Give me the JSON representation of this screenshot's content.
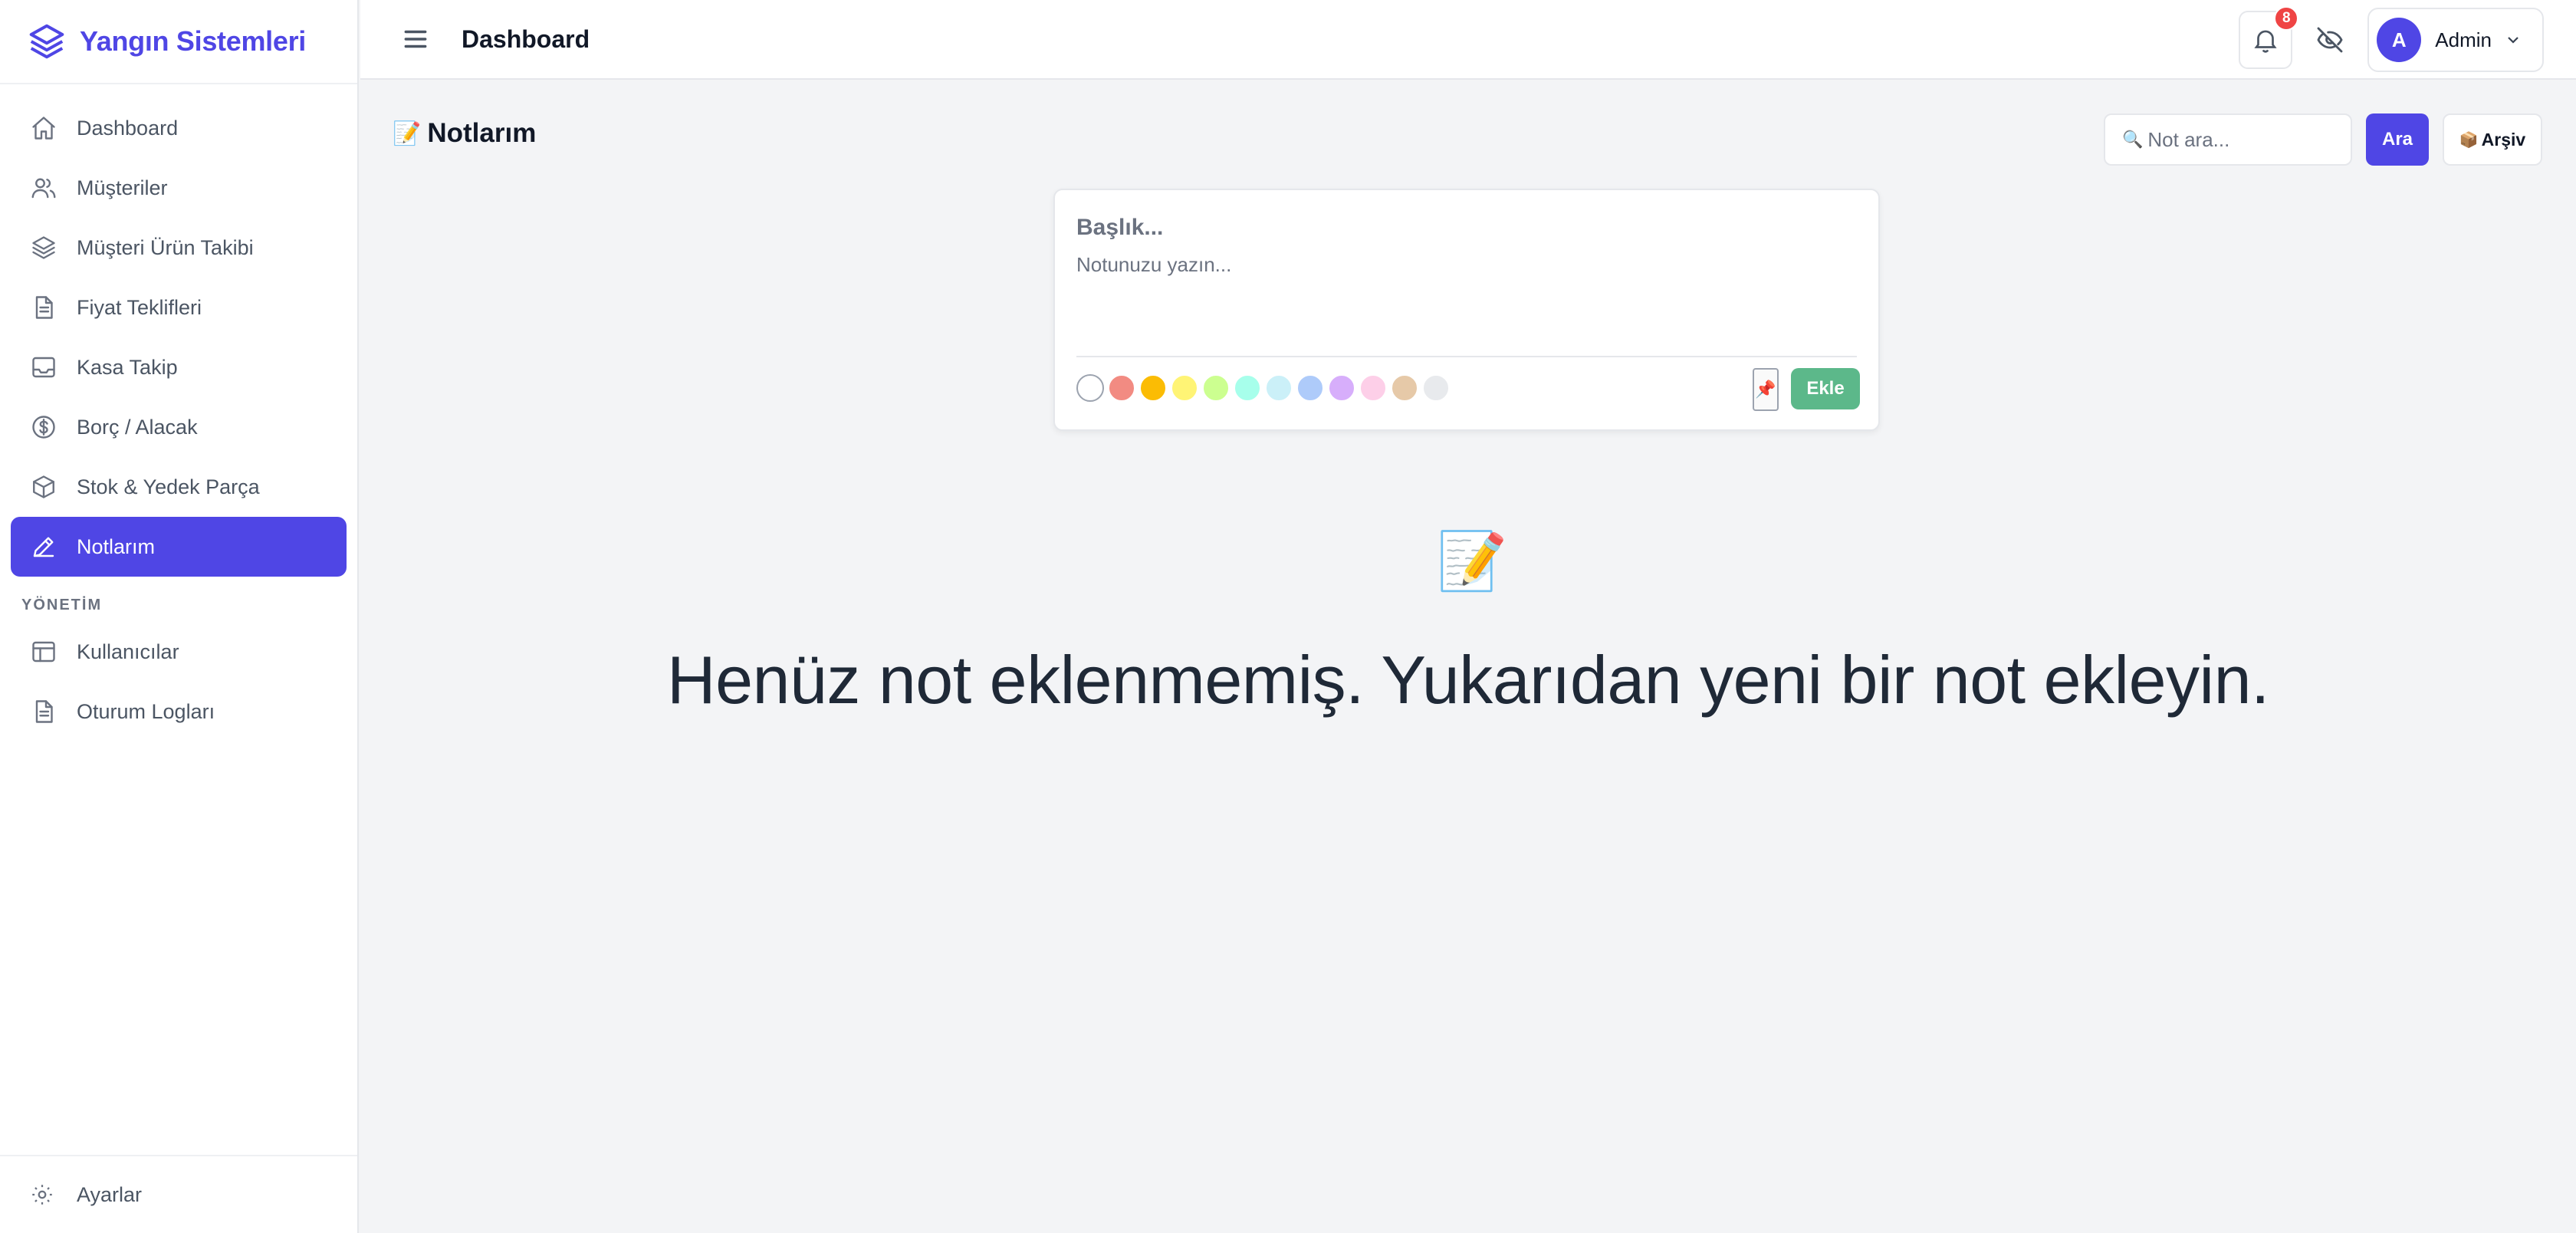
{
  "brand": {
    "name": "Yangın Sistemleri"
  },
  "sidebar": {
    "items": [
      {
        "label": "Dashboard",
        "icon": "home-icon"
      },
      {
        "label": "Müşteriler",
        "icon": "users-icon"
      },
      {
        "label": "Müşteri Ürün Takibi",
        "icon": "layers-icon"
      },
      {
        "label": "Fiyat Teklifleri",
        "icon": "document-icon"
      },
      {
        "label": "Kasa Takip",
        "icon": "inbox-icon"
      },
      {
        "label": "Borç / Alacak",
        "icon": "dollar-icon"
      },
      {
        "label": "Stok & Yedek Parça",
        "icon": "cube-icon"
      },
      {
        "label": "Notlarım",
        "icon": "pencil-icon",
        "active": true
      }
    ],
    "section_label": "YÖNETİM",
    "admin_items": [
      {
        "label": "Kullanıcılar",
        "icon": "table-icon"
      },
      {
        "label": "Oturum Logları",
        "icon": "document-icon"
      }
    ],
    "settings_label": "Ayarlar"
  },
  "header": {
    "title": "Dashboard",
    "notification_count": "8",
    "user": {
      "initial": "A",
      "name": "Admin"
    }
  },
  "main": {
    "page_title": "Notlarım",
    "page_title_emoji": "📝",
    "search": {
      "placeholder": "Not ara...",
      "emoji": "🔍"
    },
    "search_button": "Ara",
    "archive_button": "Arşiv",
    "archive_emoji": "📦",
    "note_form": {
      "title_placeholder": "Başlık...",
      "body_placeholder": "Notunuzu yazın...",
      "pin_emoji": "📌",
      "add_button": "Ekle",
      "colors": [
        "#ffffff",
        "#f28b82",
        "#fbbc04",
        "#fff475",
        "#ccff90",
        "#a7ffeb",
        "#cbf0f8",
        "#aecbfa",
        "#d7aefb",
        "#fdcfe8",
        "#e6c9a8",
        "#e8eaed"
      ]
    },
    "empty_state": {
      "emoji": "📝",
      "message": "Henüz not eklenmemiş. Yukarıdan yeni bir not ekleyin."
    }
  }
}
